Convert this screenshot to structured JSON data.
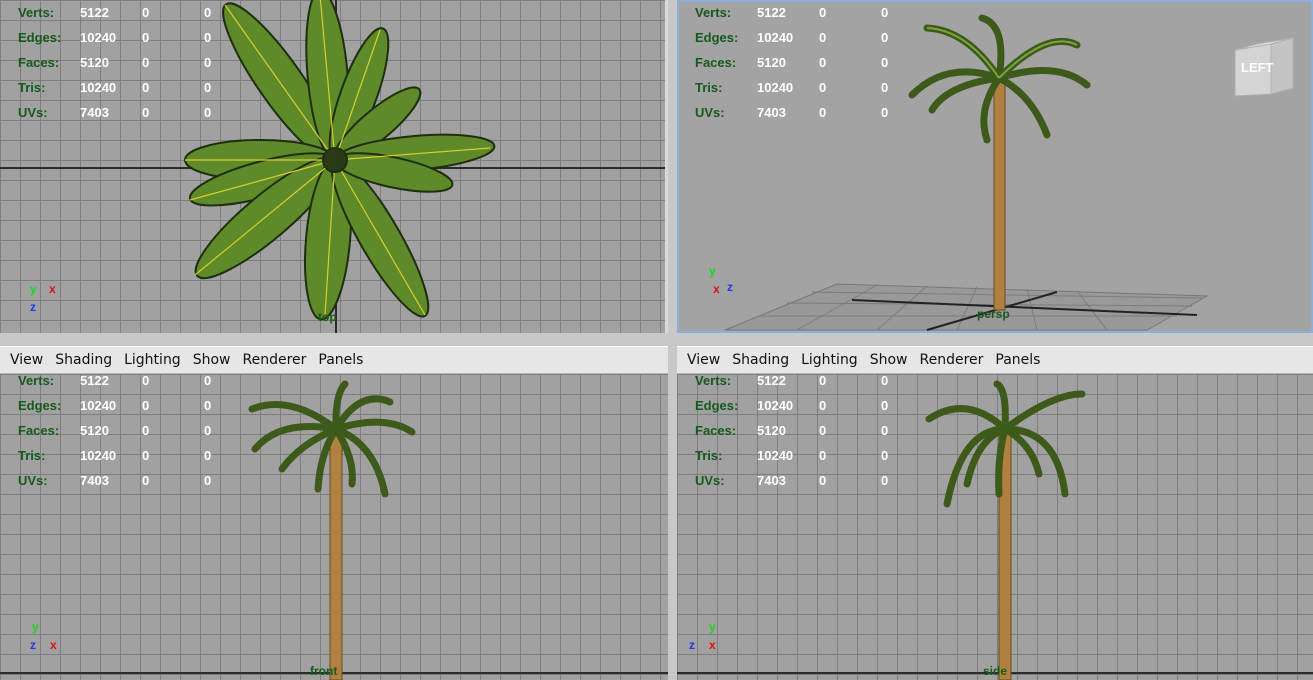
{
  "menu": [
    "View",
    "Shading",
    "Lighting",
    "Show",
    "Renderer",
    "Panels"
  ],
  "hud": [
    {
      "label": "Verts:",
      "v1": "5122",
      "v2": "0",
      "v3": "0"
    },
    {
      "label": "Edges:",
      "v1": "10240",
      "v2": "0",
      "v3": "0"
    },
    {
      "label": "Faces:",
      "v1": "5120",
      "v2": "0",
      "v3": "0"
    },
    {
      "label": "Tris:",
      "v1": "10240",
      "v2": "0",
      "v3": "0"
    },
    {
      "label": "UVs:",
      "v1": "7403",
      "v2": "0",
      "v3": "0"
    }
  ],
  "views": {
    "top": {
      "camera": "top"
    },
    "persp": {
      "camera": "persp",
      "viewcube": "LEFT"
    },
    "front": {
      "camera": "front"
    },
    "side": {
      "camera": "side"
    }
  },
  "axes": {
    "x": "x",
    "y": "y",
    "z": "z"
  },
  "colors": {
    "x": "#e01010",
    "y": "#19d619",
    "z": "#1f3ce0",
    "hud_label": "#165a1c",
    "camera_label": "#1b5a1b",
    "leaf": "#5e8a2a",
    "trunk": "#b08040"
  },
  "icons": [
    "viewcube-icon",
    "axis-gizmo-icon"
  ]
}
